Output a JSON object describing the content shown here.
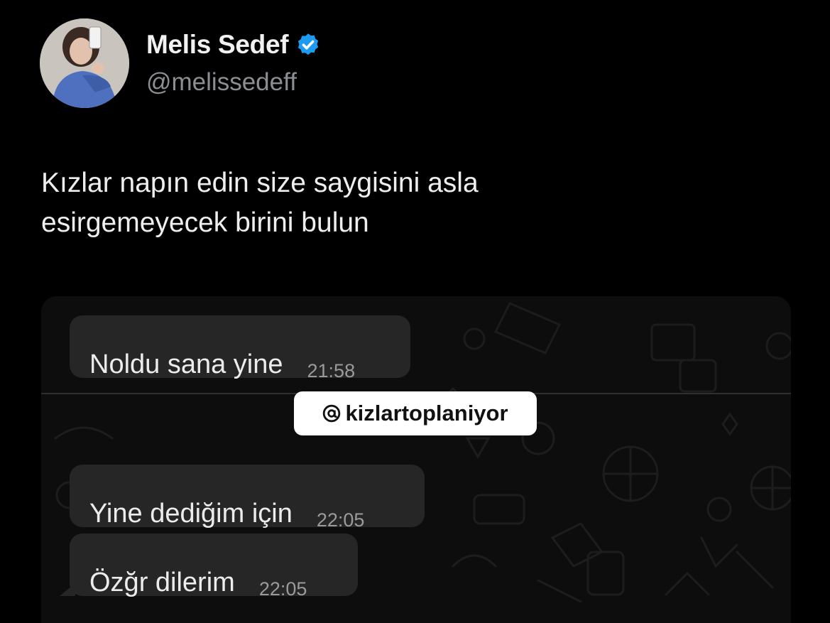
{
  "profile": {
    "display_name": "Melis Sedef",
    "handle": "@melissedeff",
    "verified": true
  },
  "tweet": {
    "line1": "Kızlar napın edin size saygisini asla",
    "line2": "esirgemeyecek birini bulun"
  },
  "chat": {
    "messages": [
      {
        "text": "Noldu sana yine",
        "time": "21:58"
      },
      {
        "text": "Yine dediğim için",
        "time": "22:05"
      },
      {
        "text": "Özğr dilerim",
        "time": "22:05"
      }
    ]
  },
  "overlay": {
    "watermark": "kizlartoplaniyor"
  },
  "colors": {
    "background": "#000000",
    "bubble": "#262626",
    "verified_badge": "#1d9bf0",
    "handle_gray": "#8b8f94"
  }
}
